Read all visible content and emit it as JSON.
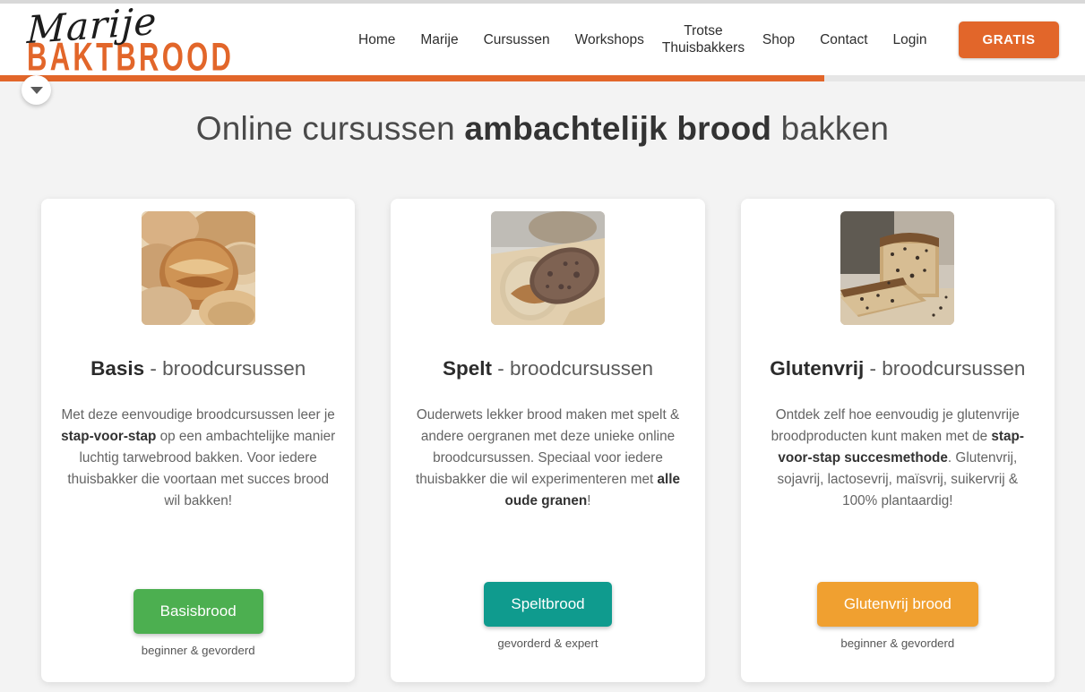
{
  "site": {
    "logo_script": "Marije",
    "logo_word": "BAKTBROOD"
  },
  "nav": {
    "items": [
      {
        "label": "Home"
      },
      {
        "label": "Marije"
      },
      {
        "label": "Cursussen"
      },
      {
        "label": "Workshops"
      },
      {
        "label": "Trotse Thuisbakkers"
      },
      {
        "label": "Shop"
      },
      {
        "label": "Contact"
      },
      {
        "label": "Login"
      }
    ],
    "cta_label": "GRATIS",
    "cta_color": "#e2662a"
  },
  "scroll_button": {
    "icon": "chevron-down-icon"
  },
  "progress": {
    "percent": 76,
    "fill_color": "#e2662a",
    "track_color": "#e6e6e6"
  },
  "heading": {
    "part1": "Online cursussen ",
    "strong": "ambachtelijk brood",
    "part2": " bakken"
  },
  "cards": [
    {
      "image_alt": "round-sourdough-loaves-in-bannetons",
      "title_strong": "Basis",
      "title_rest": " - broodcursussen",
      "text_1": "Met deze eenvoudige broodcursussen leer je ",
      "text_bold_1": "stap-voor-stap",
      "text_2": " op een ambachtelijke manier luchtig tarwebrood bakken. Voor iedere thuisbakker die voortaan met succes brood wil bakken!",
      "button_label": "Basisbrood",
      "button_color": "#4caf50",
      "caption": "beginner & gevorderd"
    },
    {
      "image_alt": "halved-spelt-bread-loaf",
      "title_strong": "Spelt",
      "title_rest": " - broodcursussen",
      "text_1": "Ouderwets lekker brood maken met spelt & andere oergranen met deze unieke online broodcursussen. Speciaal voor iedere thuisbakker die wil experimenteren met ",
      "text_bold_1": "alle oude granen",
      "text_2": "!",
      "button_label": "Speltbrood",
      "button_color": "#0f9b8e",
      "caption": "gevorderd & expert"
    },
    {
      "image_alt": "sliced-seeded-gluten-free-loaf",
      "title_strong": "Glutenvrij",
      "title_rest": " - broodcursussen",
      "text_1": "Ontdek zelf hoe eenvoudig je glutenvrije broodproducten kunt maken met de ",
      "text_bold_1": "stap-voor-stap succesmethode",
      "text_2": ". Glutenvrij, sojavrij, lactosevrij, maïsvrij, suikervrij & 100% plantaardig!",
      "button_label": "Glutenvrij brood",
      "button_color": "#f0a030",
      "caption": "beginner & gevorderd"
    }
  ]
}
